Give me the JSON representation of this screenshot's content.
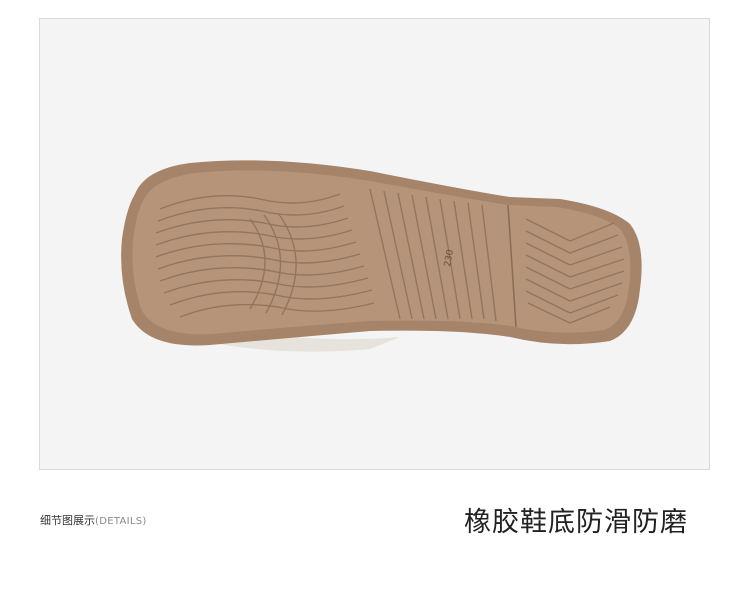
{
  "photo": {
    "subject": "shoe-sole-photo",
    "size_mark": "230",
    "colors": {
      "background": "#f4f4f4",
      "sole_edge": "#a5846a",
      "sole_fill": "#b08f74",
      "groove": "#8a6b54",
      "strap": "#e6e2dc"
    }
  },
  "captions": {
    "details_cn": "细节图展示",
    "details_en": "(DETAILS)",
    "feature": "橡胶鞋底防滑防磨"
  }
}
